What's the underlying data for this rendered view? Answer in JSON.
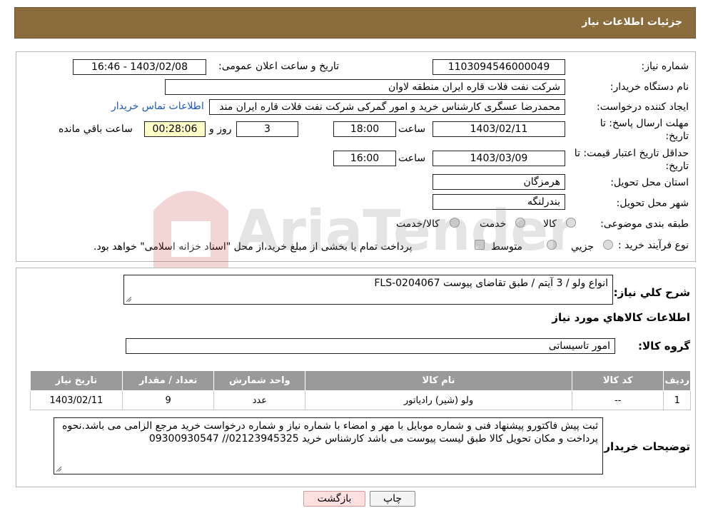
{
  "header": {
    "title": "جزئیات اطلاعات نیاز"
  },
  "details": {
    "need_number_label": "شماره نیاز:",
    "need_number": "1103094546000049",
    "announce_label": "تاریخ و ساعت اعلان عمومی:",
    "announce_value": "1403/02/08 - 16:46",
    "buyer_org_label": "نام دستگاه خریدار:",
    "buyer_org": "شرکت نفت فلات قاره ایران منطقه لاوان",
    "creator_label": "ایجاد کننده درخواست:",
    "creator": "محمدرضا عسگری کارشناس خرید و امور گمرکی شرکت نفت فلات قاره ایران مند",
    "contact_link": "اطلاعات تماس خریدار",
    "deadline_label_1": "مهلت ارسال پاسخ: تا",
    "deadline_label_2": "تاریخ:",
    "deadline_date": "1403/02/11",
    "time_label": "ساعت",
    "deadline_time": "18:00",
    "days_value": "3",
    "days_label": "روز و",
    "remaining_time": "00:28:06",
    "remaining_label": "ساعت باقي مانده",
    "validity_label_1": "حداقل تاریخ اعتبار قیمت: تا",
    "validity_label_2": "تاریخ:",
    "validity_date": "1403/03/09",
    "validity_time": "16:00",
    "province_label": "استان محل تحویل:",
    "province": "هرمزگان",
    "city_label": "شهر محل تحویل:",
    "city": "بندرلنگه",
    "category_label": "طبقه بندی موضوعی:",
    "category_options": [
      "کالا",
      "خدمت",
      "کالا/خدمت"
    ],
    "process_label": "نوع فرآیند خرید :",
    "process_options": [
      "جزیي",
      "متوسط"
    ],
    "process_note": "پرداخت تمام یا بخشی از مبلغ خرید،از محل \"اسناد خزانه اسلامی\" خواهد بود."
  },
  "summary": {
    "label": "شرح کلي نياز:",
    "value": "انواع ولو / 3 آیتم / طبق تقاضای پیوست FLS-0204067",
    "items_title": "اطلاعات کالاهاي مورد نياز",
    "group_label": "گروه کالا:",
    "group_value": "امور تاسیساتی"
  },
  "table": {
    "headers": [
      "رديف",
      "کد کالا",
      "نام کالا",
      "واحد شمارش",
      "تعداد / مقدار",
      "تاريخ نياز"
    ],
    "rows": [
      [
        "1",
        "--",
        "ولو (شیر) رادیاتور",
        "عدد",
        "9",
        "1403/02/11"
      ]
    ]
  },
  "buyer_notes": {
    "label": "توضیحات خریدار:",
    "text": "ثبت پیش فاکتورو پیشنهاد فنی و شماره موبایل با مهر و امضاء با شماره نیاز و شماره درخواست خرید مرجع الزامی می باشد.نحوه پرداخت و مکان تحویل کالا طبق لیست پیوست می باشد کارشناس خرید 02123945325// 09300930547"
  },
  "buttons": {
    "print": "چاپ",
    "back": "بازگشت"
  },
  "watermark": "AriaTender.neT",
  "colors": {
    "header": "#8a6c3d",
    "table_header": "#9a9a9a",
    "link": "#1a57c7",
    "back_button": "#fde0e0",
    "print_button": "#f4f4f4"
  }
}
